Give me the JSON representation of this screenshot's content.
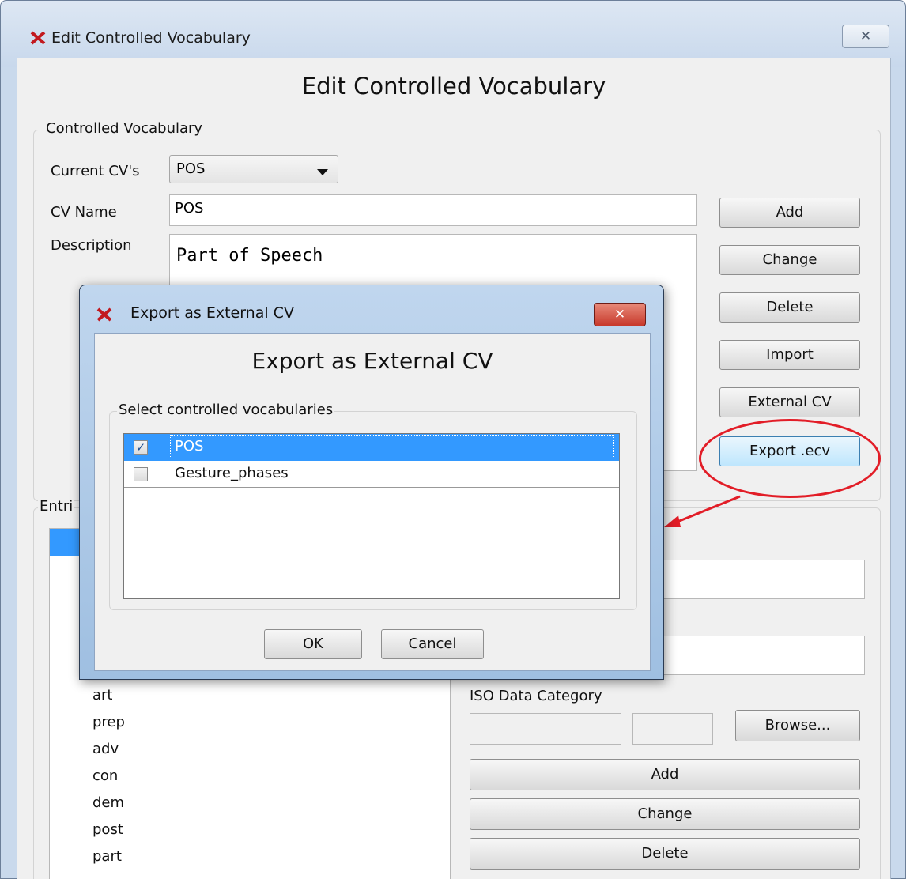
{
  "main_window": {
    "title": "Edit Controlled Vocabulary",
    "close_glyph": "✕",
    "heading": "Edit Controlled Vocabulary",
    "cv_group": {
      "legend": "Controlled Vocabulary",
      "current_cvs_label": "Current CV's",
      "current_cvs_value": "POS",
      "cv_name_label": "CV Name",
      "cv_name_value": "POS",
      "description_label": "Description",
      "description_value": "Part of Speech",
      "buttons": {
        "add": "Add",
        "change": "Change",
        "delete": "Delete",
        "import": "Import",
        "external_cv": "External CV",
        "export_ecv": "Export .ecv"
      }
    },
    "entries_group": {
      "legend": "Entri",
      "items": [
        "art",
        "prep",
        "adv",
        "con",
        "dem",
        "post",
        "part"
      ],
      "iso_label": "ISO Data Category",
      "browse": "Browse...",
      "add": "Add",
      "change": "Change",
      "delete": "Delete"
    }
  },
  "dialog": {
    "title": "Export as External CV",
    "heading": "Export as External CV",
    "close_glyph": "✕",
    "group_legend": "Select controlled vocabularies",
    "rows": [
      {
        "label": "POS",
        "checked": true
      },
      {
        "label": "Gesture_phases",
        "checked": false
      }
    ],
    "ok": "OK",
    "cancel": "Cancel"
  },
  "colors": {
    "selection": "#3399ff",
    "annotation": "#e21d27"
  }
}
